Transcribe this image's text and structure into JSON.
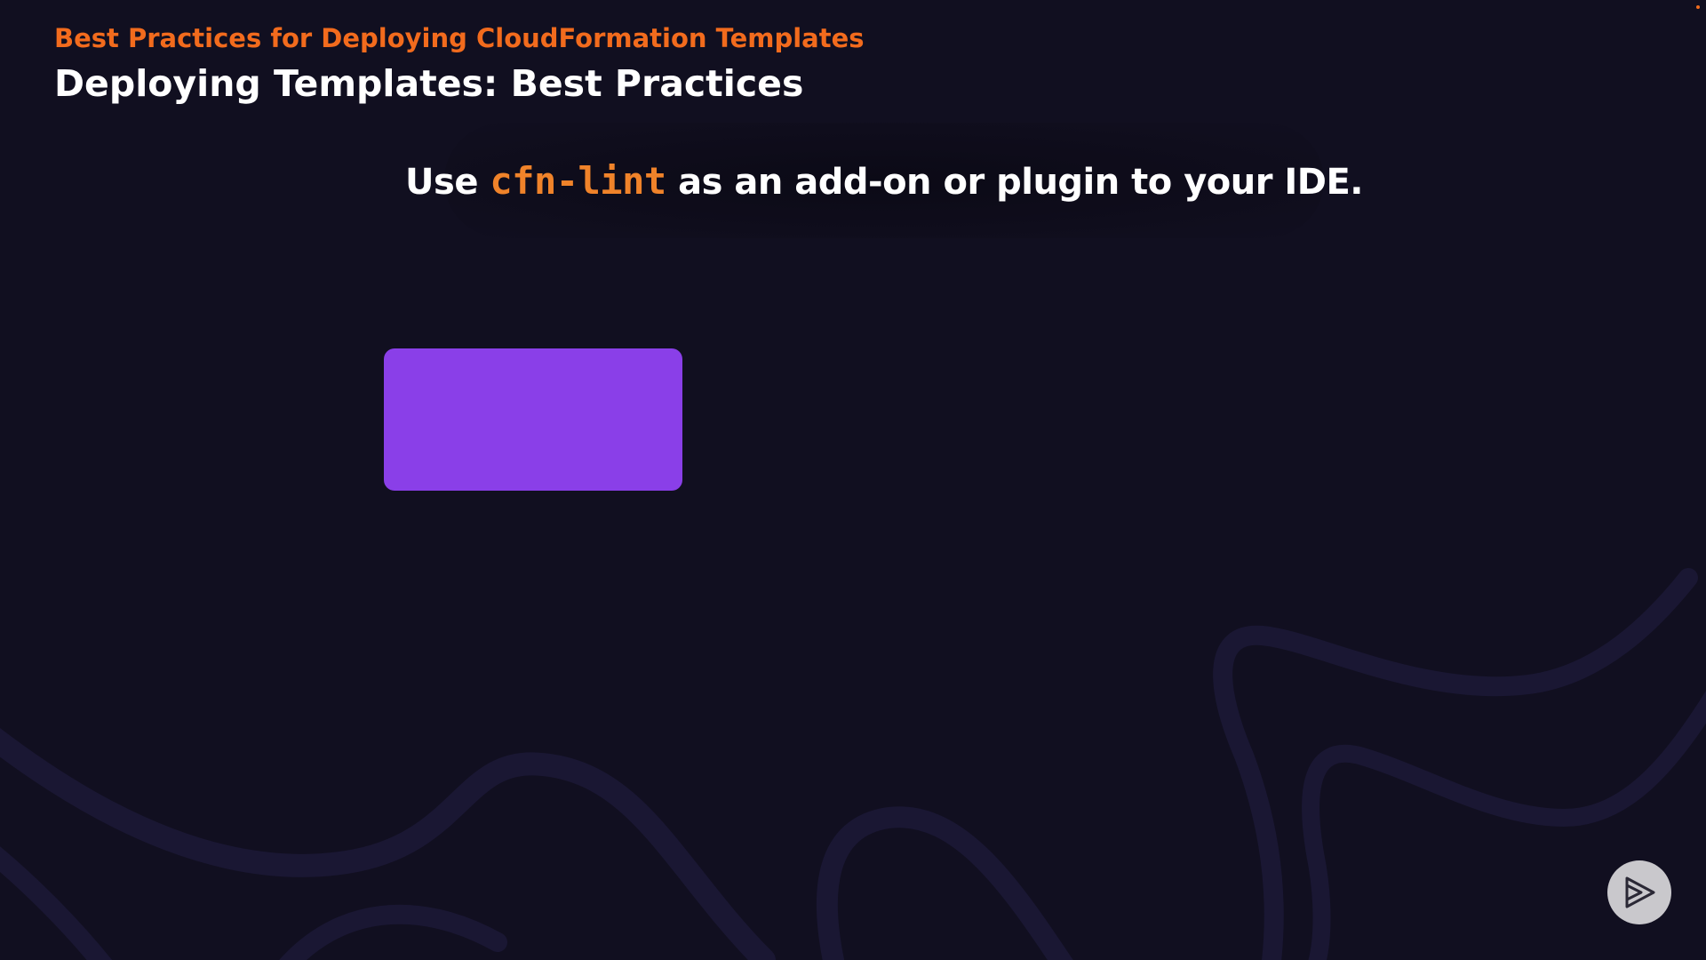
{
  "header": {
    "course_title": "Best Practices for Deploying CloudFormation Templates",
    "slide_title": "Deploying Templates: Best Practices"
  },
  "callout": {
    "prefix": "Use ",
    "code_term": "cfn-lint",
    "suffix": " as an add-on or plugin to your IDE."
  },
  "colors": {
    "background": "#110f20",
    "accent_orange": "#f26b1d",
    "code_orange": "#f0832a",
    "box_purple": "#8a3fe8",
    "wave_lines": "#1a1733"
  },
  "icons": {
    "logo": "play-logo-icon"
  }
}
